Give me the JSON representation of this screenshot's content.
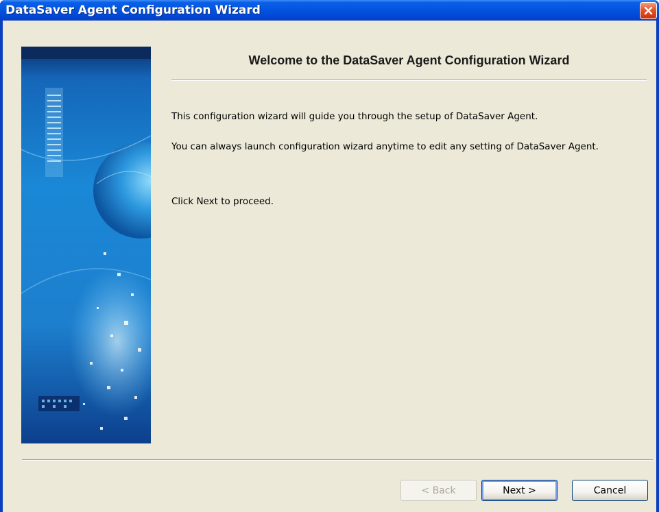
{
  "window": {
    "title": "DataSaver Agent Configuration Wizard",
    "close_icon": "close-icon"
  },
  "wizard": {
    "heading": "Welcome to the DataSaver Agent Configuration Wizard",
    "line1": "This configuration wizard will guide you through the setup of DataSaver Agent.",
    "line2": "You can always launch configuration wizard anytime to edit any setting of DataSaver Agent.",
    "line3": "Click Next to proceed.",
    "side_image": "globe-network-banner"
  },
  "buttons": {
    "back": "< Back",
    "next": "Next >",
    "cancel": "Cancel",
    "back_enabled": false
  },
  "colors": {
    "titlebar": "#0355e0",
    "client": "#ece9d8",
    "close": "#e2552a"
  }
}
